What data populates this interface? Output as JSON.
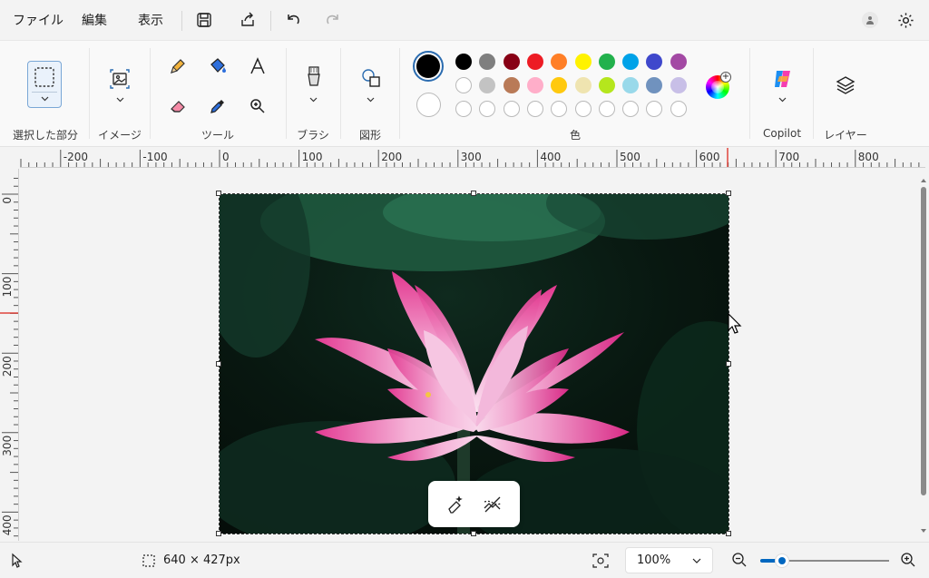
{
  "menubar": {
    "file": "ファイル",
    "edit": "編集",
    "view": "表示"
  },
  "ribbon": {
    "groups": {
      "selection": "選択した部分",
      "image": "イメージ",
      "tools": "ツール",
      "brushes": "ブラシ",
      "shapes": "図形",
      "colors": "色",
      "copilot": "Copilot",
      "layers": "レイヤー"
    },
    "palette": {
      "row1": [
        "#000000",
        "#7f7f7f",
        "#880015",
        "#ed1c24",
        "#ff7f27",
        "#fff200",
        "#22b14c",
        "#00a2e8",
        "#3f48cc",
        "#a349a4"
      ],
      "row2": [
        "#ffffff",
        "#c3c3c3",
        "#b97a57",
        "#ffaec9",
        "#ffc90e",
        "#efe4b0",
        "#b5e61d",
        "#99d9ea",
        "#7092be",
        "#c8bfe7"
      ],
      "primary": "#000000",
      "secondary": "#ffffff"
    }
  },
  "ruler": {
    "h_labels": [
      "-200",
      "-100",
      "0",
      "100",
      "200",
      "300",
      "400",
      "500",
      "600",
      "700",
      "800"
    ],
    "v_labels": [
      "0",
      "100",
      "200",
      "300",
      "400"
    ]
  },
  "status": {
    "image_size": "640 × 427px",
    "zoom": "100%",
    "zoom_slider_fraction": 0.17
  }
}
